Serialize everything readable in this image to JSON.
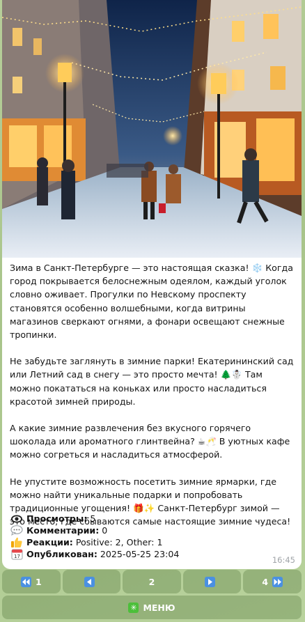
{
  "post": {
    "paragraphs": [
      {
        "text": "Зима в Санкт-Петербурге — это настоящая сказка! ❄️ Когда город покрывается белоснежным одеялом, каждый уголок словно оживает. Прогулки по Невскому проспекту становятся особенно волшебными, когда витрины магазинов сверкают огнями, а фонари освещают снежные тропинки."
      },
      {
        "text": "Не забудьте заглянуть в зимние парки! Екатерининский сад или Летний сад в снегу — это просто мечта! 🌲☃️ Там можно покататься на коньках или просто насладиться красотой зимней природы."
      },
      {
        "text": "А какие зимние развлечения без вкусного горячего шоколада или ароматного глинтвейна? ☕🥂 В уютных кафе можно согреться и насладиться атмосферой."
      },
      {
        "text": "Не упустите возможность посетить зимние ярмарки, где можно найти уникальные подарки и попробовать традиционные угощения! 🎁✨ Санкт-Петербург зимой — это место, где сбываются самые настоящие зимние чудеса!"
      }
    ],
    "stats": [
      {
        "icon": "eye-icon",
        "label": "Просмотры:",
        "value": "5"
      },
      {
        "icon": "speech-bubble-icon",
        "label": "Комментарии:",
        "value": "0"
      },
      {
        "icon": "thumbs-up-icon",
        "label": "Реакции:",
        "value": "Positive: 2, Other: 1"
      },
      {
        "icon": "calendar-icon",
        "label": "Опубликован:",
        "value": "2025-05-25 23:04"
      }
    ],
    "time": "16:45"
  },
  "keyboard": {
    "first": "1",
    "prev": "",
    "current": "2",
    "next": "",
    "last": "4",
    "menu": "МЕНЮ"
  },
  "colors": {
    "background": "#b0ca92",
    "bubble": "#ffffff",
    "button": "#6e8f55"
  }
}
